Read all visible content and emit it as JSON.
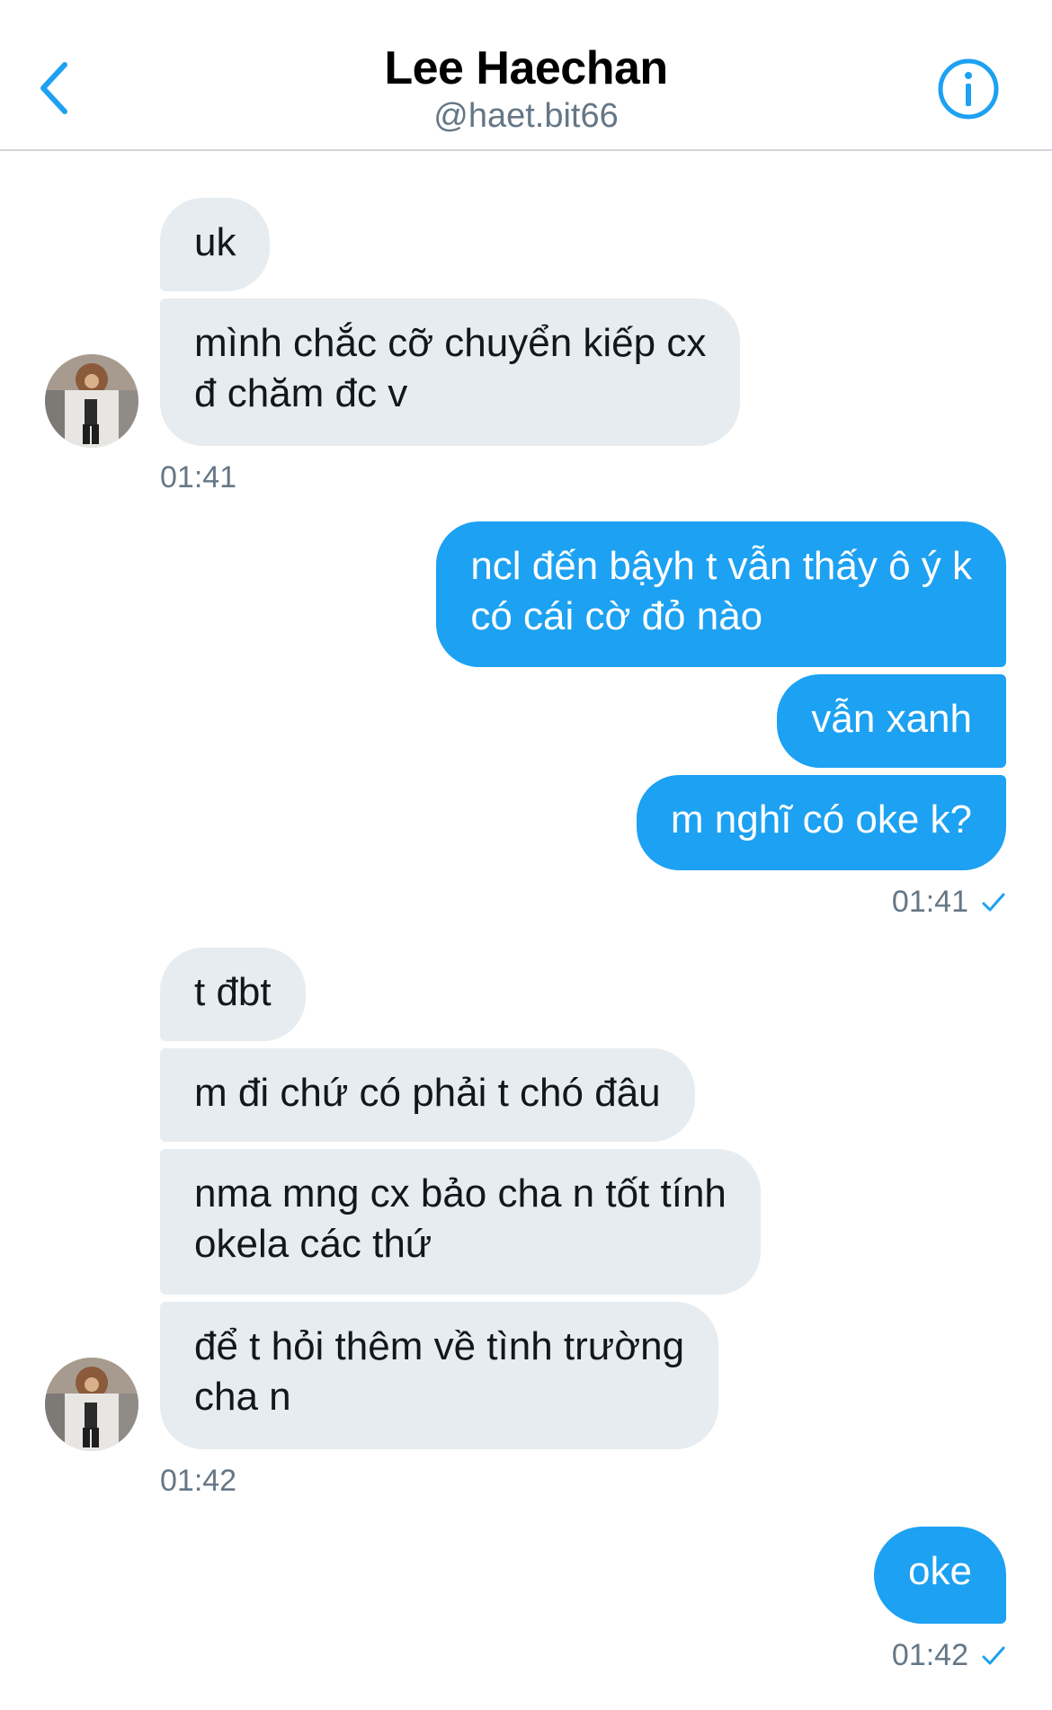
{
  "header": {
    "name": "Lee Haechan",
    "handle": "@haet.bit66",
    "back_icon": "chevron-left-icon",
    "info_icon": "info-icon"
  },
  "colors": {
    "accent": "#1da1f2",
    "incoming_bubble": "#e6ecf0",
    "timestamp": "#657786"
  },
  "messages": {
    "group1": {
      "m1": "uk",
      "m2_line1": "mình chắc cỡ chuyển kiếp cx",
      "m2_line2": "đ chăm đc v",
      "time": "01:41"
    },
    "group2": {
      "m1_line1": "ncl đến bậyh t vẫn thấy ô ý k",
      "m1_line2": "có cái cờ đỏ nào",
      "m2": "vẫn xanh",
      "m3": "m nghĩ có oke k?",
      "time": "01:41"
    },
    "group3": {
      "m1": "t đbt",
      "m2": "m đi chứ có phải t chó đâu",
      "m3_line1": "nma mng cx bảo cha n tốt tính",
      "m3_line2": "okela các thứ",
      "m4_line1": "để t hỏi thêm về tình trường",
      "m4_line2": "cha n",
      "time": "01:42"
    },
    "group4": {
      "m1": "oke",
      "time": "01:42"
    }
  }
}
